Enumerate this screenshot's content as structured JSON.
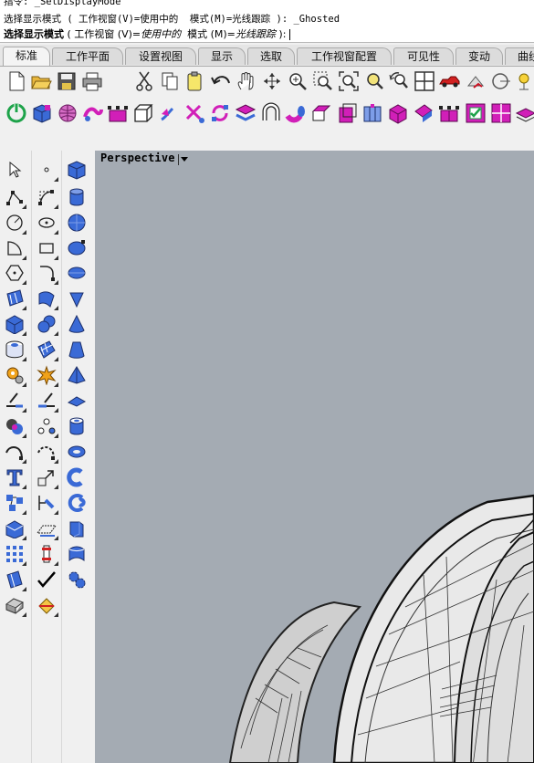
{
  "command": {
    "history_partial": "指令: _SetDisplayMode",
    "history_line": "选择显示模式 ( 工作视窗(V)=使用中的  模式(M)=光线跟踪 ): _Ghosted",
    "prompt_label": "选择显示模式",
    "prompt_open": " ( 工作视窗 ",
    "opt_v": "(V)=",
    "opt_v_val": "使用中的",
    "prompt_mid": "  模式 ",
    "opt_m": "(M)=",
    "opt_m_val": "光线跟踪",
    "prompt_close": " ):"
  },
  "tabs": [
    "标准",
    "工作平面",
    "设置视图",
    "显示",
    "选取",
    "工作视窗配置",
    "可见性",
    "变动",
    "曲线"
  ],
  "active_tab": "标准",
  "toolbar1_icons": [
    "new-file-icon",
    "open-folder-icon",
    "save-icon",
    "print-icon",
    "cut-icon",
    "copy-icon",
    "paste-icon",
    "undo-icon",
    "pan-hand-icon",
    "rotate-view-icon",
    "zoom-dynamic-icon",
    "zoom-window-icon",
    "zoom-extents-icon",
    "zoom-selected-icon",
    "undo-view-icon",
    "four-viewports-icon",
    "car-render-icon",
    "render-preview-icon",
    "circle-snap-icon",
    "light-icon"
  ],
  "toolbar2_icons": [
    "power-icon",
    "box-cube-icon",
    "sphere-mesh-icon",
    "blend-surface-icon",
    "control-points-icon",
    "box-frame-icon",
    "arrow-curve-icon",
    "scissors-icon",
    "cycle-icon",
    "surface-patch-icon",
    "magnet-icon",
    "pipe-icon",
    "extrude-edge-icon",
    "solid-offset-icon",
    "split-panel-icon",
    "cube-edit-icon",
    "shear-icon",
    "cage-icon",
    "checkbox-icon",
    "grid-square-icon",
    "solid-stack-icon"
  ],
  "left_col1": [
    "select-arrow-icon",
    "polyline-icon",
    "circle-icon",
    "arc-icon",
    "polygon-icon",
    "surface-patch-icon",
    "solid-box-icon",
    "cylinder-hole-icon",
    "gear-settings-icon",
    "trim-icon",
    "boolean-icon",
    "curve-tool-icon",
    "text-icon",
    "array-icon",
    "solid-edit-icon",
    "grid-array-icon",
    "blue-panel-icon",
    "cube-grey-icon"
  ],
  "left_col2": [
    "point-icon",
    "control-curve-icon",
    "ellipse-icon",
    "rectangle-icon",
    "fillet-curve-icon",
    "surface-bend-icon",
    "sphere-group-icon",
    "surface-grid-icon",
    "explode-icon",
    "split-icon",
    "points-icon",
    "arc-dashed-icon",
    "scale-icon",
    "dimension-icon",
    "plane-icon",
    "column-icon",
    "checkmark-icon",
    "paint-bucket-icon"
  ],
  "left_col3": [
    "cube-icon",
    "cylinder-icon",
    "sphere-icon",
    "ellipsoid-icon",
    "paraboloid-icon",
    "cone-icon",
    "cone-solid-icon",
    "truncated-cone-icon",
    "pyramid-icon",
    "plane-solid-icon",
    "tube-icon",
    "torus-icon",
    "torus-half-icon",
    "torus-curl-icon",
    "extrude-panel-icon",
    "pipe-panel-icon",
    "gear-blue-icon"
  ],
  "viewport": {
    "title": "Perspective"
  },
  "colors": {
    "viewport_bg": "#a4abb3",
    "icon_blue": "#2f59c8",
    "icon_magenta": "#d11fb8"
  }
}
